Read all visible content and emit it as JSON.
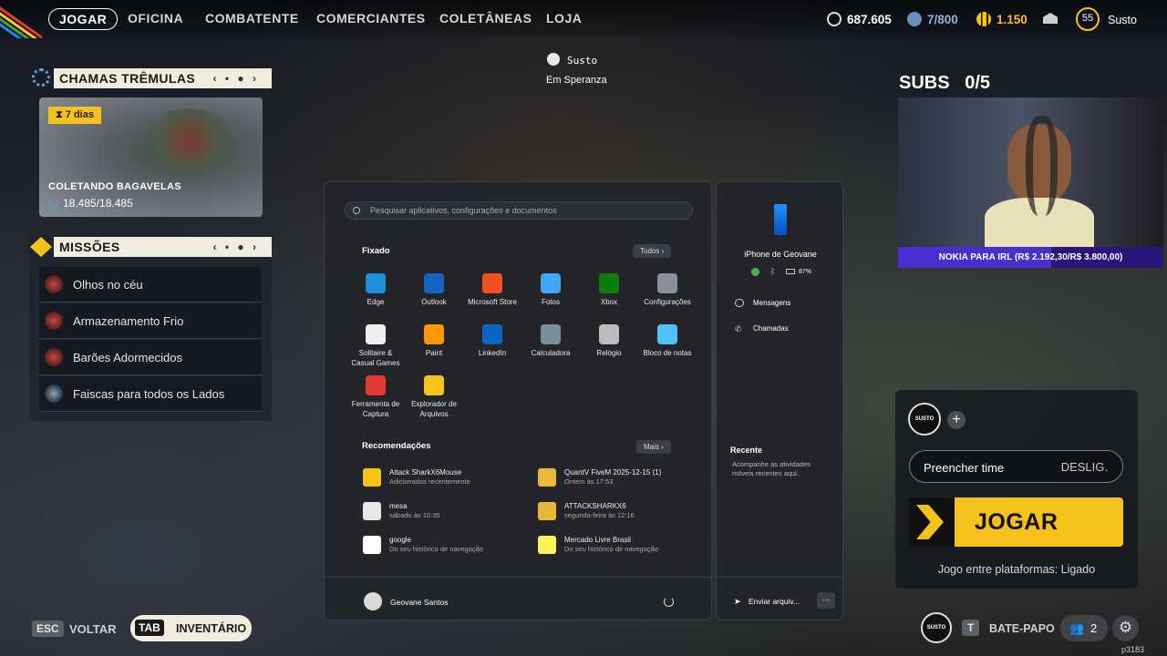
{
  "nav": {
    "items": [
      "JOGAR",
      "OFICINA",
      "COMBATENTE",
      "COMERCIANTES",
      "COLETÂNEAS",
      "LOJA"
    ],
    "currency1": "687.605",
    "currency2": "7/800",
    "currency3": "1.150",
    "level": "55",
    "username": "Susto"
  },
  "center_player": {
    "name": "Susto",
    "location": "Em Speranza"
  },
  "event_panel": {
    "title": "CHAMAS TRÊMULAS",
    "badge": "7 dias",
    "event_name": "COLETANDO BAGAVELAS",
    "progress": "18.485/18.485",
    "progress_fraction": 1.0
  },
  "missions": {
    "title": "MISSÕES",
    "items": [
      "Olhos no céu",
      "Armazenamento Frio",
      "Barões Adormecidos",
      "Faiscas para todos os Lados"
    ]
  },
  "start_menu": {
    "search_placeholder": "Pesquisar aplicativos, configurações e documentos",
    "pinned_title": "Fixado",
    "all_label": "Todos",
    "apps": [
      {
        "l1": "Edge",
        "l2": ""
      },
      {
        "l1": "Outlook",
        "l2": ""
      },
      {
        "l1": "Microsoft Store",
        "l2": ""
      },
      {
        "l1": "Fotos",
        "l2": ""
      },
      {
        "l1": "Xbox",
        "l2": ""
      },
      {
        "l1": "Configurações",
        "l2": ""
      },
      {
        "l1": "Solitaire &",
        "l2": "Casual Games"
      },
      {
        "l1": "Paint",
        "l2": ""
      },
      {
        "l1": "LinkedIn",
        "l2": ""
      },
      {
        "l1": "Calculadora",
        "l2": ""
      },
      {
        "l1": "Relógio",
        "l2": ""
      },
      {
        "l1": "Bloco de notas",
        "l2": ""
      },
      {
        "l1": "Ferramenta de",
        "l2": "Captura"
      },
      {
        "l1": "Explorador de",
        "l2": "Arquivos"
      }
    ],
    "app_colors": [
      "#1e8fd8",
      "#1565c0",
      "#f25022",
      "#42a5f5",
      "#107c10",
      "#8a8f99",
      "#eeeeee",
      "#ff9800",
      "#0a66c2",
      "#78909c",
      "#bdbdbd",
      "#4fc3f7",
      "#e53935",
      "#f5c518"
    ],
    "rec_title": "Recomendações",
    "more_label": "Mais",
    "recs": [
      {
        "t": "Attack SharkX6Mouse",
        "s": "Adicionados recentemente",
        "c": "#f5c518"
      },
      {
        "t": "QuantV FiveM 2025-12-15 (1)",
        "s": "Ontem às 17:53",
        "c": "#e6b93a"
      },
      {
        "t": "mesa",
        "s": "sábado às 10:35",
        "c": "#e8e8e8"
      },
      {
        "t": "ATTACKSHARKX6",
        "s": "segunda-feira às 12:16",
        "c": "#e6b93a"
      },
      {
        "t": "google",
        "s": "Do seu histórico de navegação",
        "c": "#ffffff"
      },
      {
        "t": "Mercado Livre Brasil",
        "s": "Do seu histórico de navegação",
        "c": "#fff159"
      }
    ],
    "user": "Geovane Santos"
  },
  "phone_panel": {
    "device": "iPhone de Geovane",
    "battery": "87%",
    "messages": "Mensagens",
    "calls": "Chamadas",
    "recent_title": "Recente",
    "recent_desc1": "Acompanhe as atividades",
    "recent_desc2": "móveis recentes aqui.",
    "send": "Enviar arquiv..."
  },
  "overlay": {
    "subs": "SUBS   0/5",
    "banner": "NOKIA PARA IRL (R$ 2.192,30/R$ 3.800,00)",
    "banner_progress_fraction": 0.577
  },
  "party": {
    "avatar_label": "SUSTO",
    "fill_label": "Preencher time",
    "fill_state": "DESLIG.",
    "play": "JOGAR",
    "crossplay": "Jogo entre plataformas: Ligado"
  },
  "bottom": {
    "esc": "ESC",
    "back": "VOLTAR",
    "tab": "TAB",
    "inventory": "INVENTÁRIO",
    "t_key": "T",
    "chat": "BATE-PAPO",
    "friends": "2",
    "corner": "p3183"
  },
  "colors": {
    "accent_yellow": "#f5c21b",
    "panel_header": "#f1ecde",
    "overlay_purple": "#3a1a9e"
  }
}
